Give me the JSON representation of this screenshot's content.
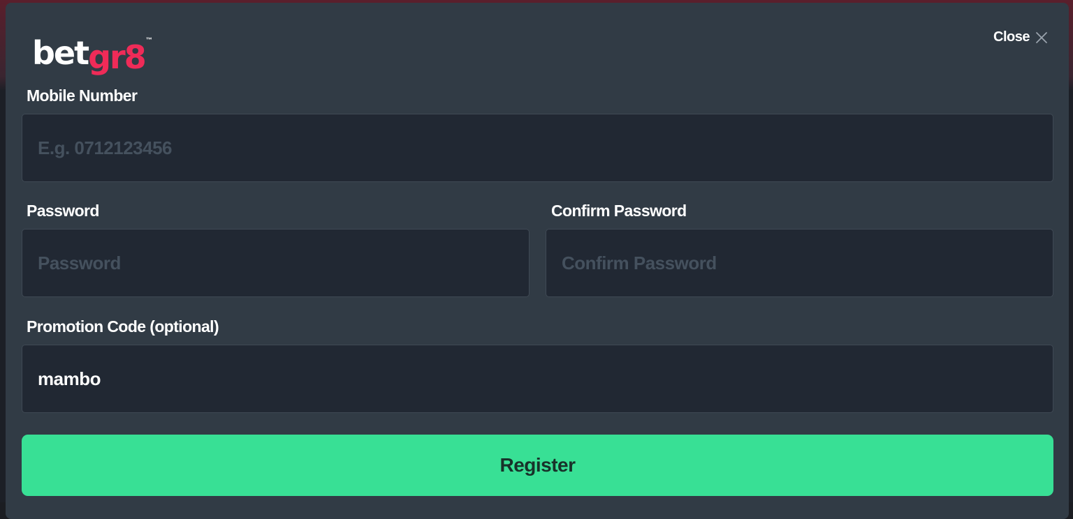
{
  "brand": {
    "logo_text_white": "bet",
    "logo_text_accent": "gr8",
    "trademark": "™",
    "accent_color": "#ef2b58"
  },
  "header": {
    "close_label": "Close",
    "close_icon": "close-icon"
  },
  "form": {
    "mobile": {
      "label": "Mobile Number",
      "placeholder": "E.g. 0712123456",
      "value": ""
    },
    "password": {
      "label": "Password",
      "placeholder": "Password",
      "value": ""
    },
    "confirm_password": {
      "label": "Confirm Password",
      "placeholder": "Confirm Password",
      "value": ""
    },
    "promo": {
      "label": "Promotion Code (optional)",
      "placeholder": "",
      "value": "mambo"
    },
    "register_label": "Register",
    "register_color": "#38e095"
  }
}
